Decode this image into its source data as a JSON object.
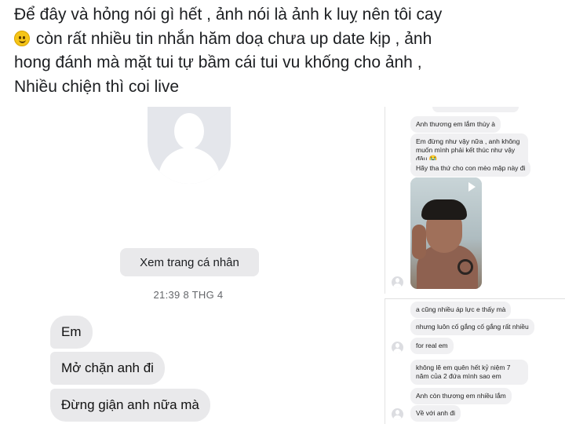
{
  "post": {
    "line1": "Để đây và hỏng nói gì hết , ảnh nói là ảnh k luỵ nên tôi cay",
    "line2": " còn rất nhiều tin nhắn hăm doạ chưa up date kịp  , ảnh",
    "line3": "hong đánh mà mặt tui tự bầm cái tui vu khống cho ảnh ,",
    "line4": "Nhiều chiện thì coi live"
  },
  "left_chat": {
    "profile_button": "Xem trang cá nhân",
    "timestamp": "21:39 8 THG 4",
    "messages": [
      "Em",
      "Mở chặn anh đi",
      "Đừng giận anh nữa mà"
    ]
  },
  "right_chat_1": {
    "messages": [
      "Anh thương em lắm thùy à",
      "Em đừng như vậy nữa , anh không muốn mình phải kết thúc như vậy đâu 😭",
      "Hãy tha thứ cho con mèo mập này đi"
    ]
  },
  "right_chat_2": {
    "messages": [
      "a cũng nhiều áp lực e thấy mà",
      "nhưng luôn cố gắng cố gắng rất nhiều",
      "for real em",
      "không lẽ em quên hết kỷ niệm 7 năm của 2 đứa mình sao em",
      "Anh còn thương em nhiều lắm",
      "Về với anh đi"
    ]
  },
  "colors": {
    "bubble_gray": "#e9e9eb",
    "text_dark": "#1c1e21",
    "timestamp_gray": "#65676b"
  },
  "icons": [
    "smile-emoji-icon",
    "default-avatar-icon",
    "video-play-icon"
  ]
}
